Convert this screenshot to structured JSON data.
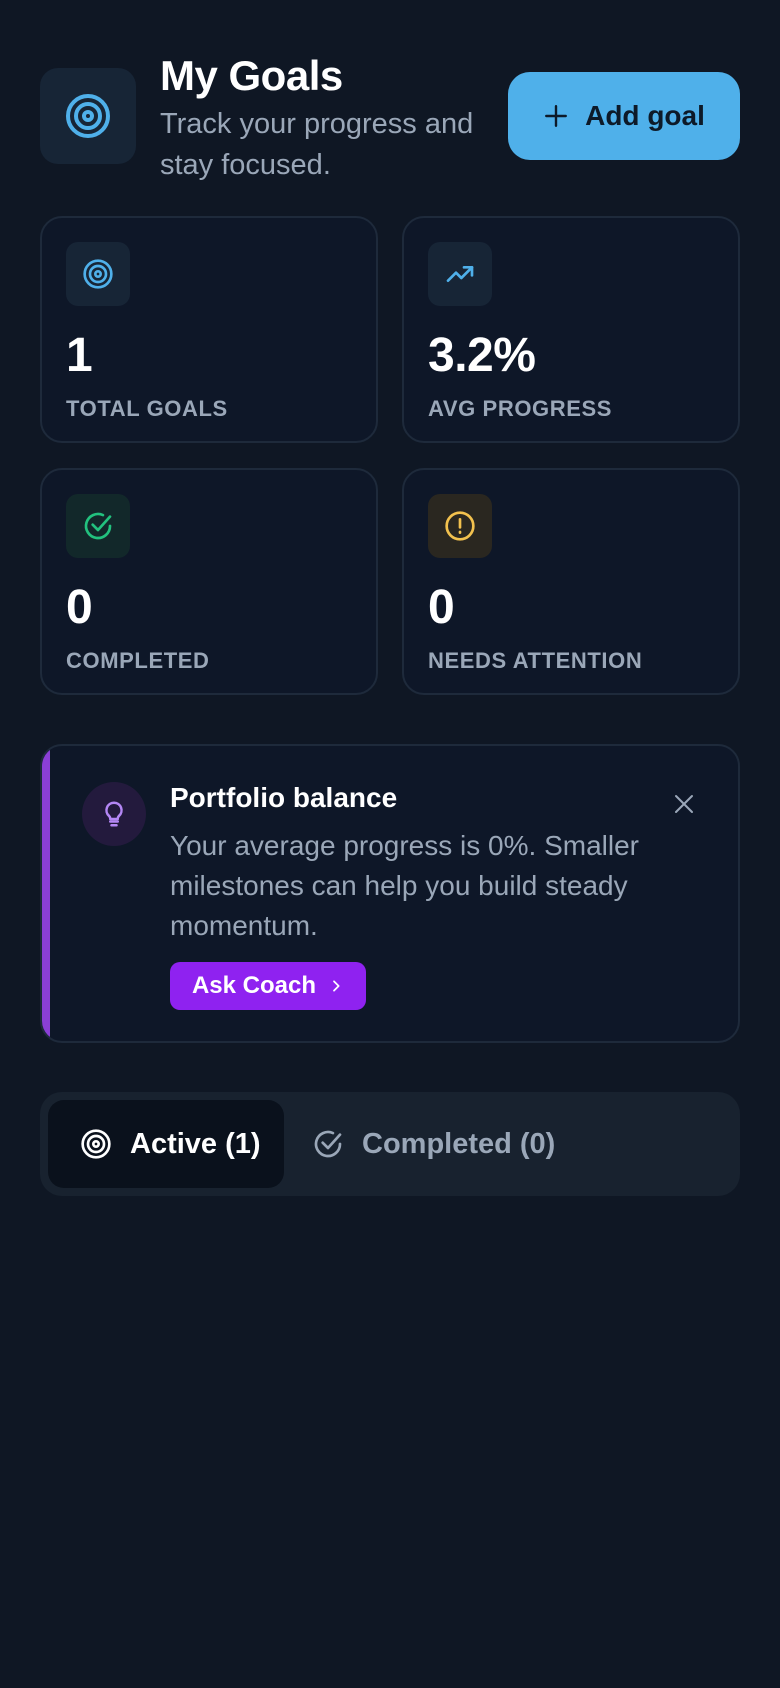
{
  "header": {
    "title": "My Goals",
    "subtitle": "Track your progress and stay focused.",
    "add_button_label": "Add goal",
    "icon": "target-icon"
  },
  "stats": [
    {
      "value": "1",
      "label": "TOTAL GOALS",
      "icon": "target-icon",
      "color": "#4fb0ea"
    },
    {
      "value": "3.2%",
      "label": "AVG PROGRESS",
      "icon": "trending-up-icon",
      "color": "#4fb0ea"
    },
    {
      "value": "0",
      "label": "COMPLETED",
      "icon": "check-circle-icon",
      "color": "#22c17e"
    },
    {
      "value": "0",
      "label": "NEEDS ATTENTION",
      "icon": "alert-circle-icon",
      "color": "#f2c14e"
    }
  ],
  "insight": {
    "title": "Portfolio balance",
    "body": "Your average progress is 0%. Smaller milestones can help you build steady momentum.",
    "button_label": "Ask Coach",
    "icon": "lightbulb-icon",
    "accent_color": "#8b3fd6"
  },
  "tabs": [
    {
      "label": "Active (1)",
      "icon": "target-icon",
      "active": true
    },
    {
      "label": "Completed (0)",
      "icon": "check-circle-icon",
      "active": false
    }
  ],
  "colors": {
    "background": "#0f1724",
    "accent": "#4fb0ea",
    "coach_button": "#8f22f0"
  }
}
